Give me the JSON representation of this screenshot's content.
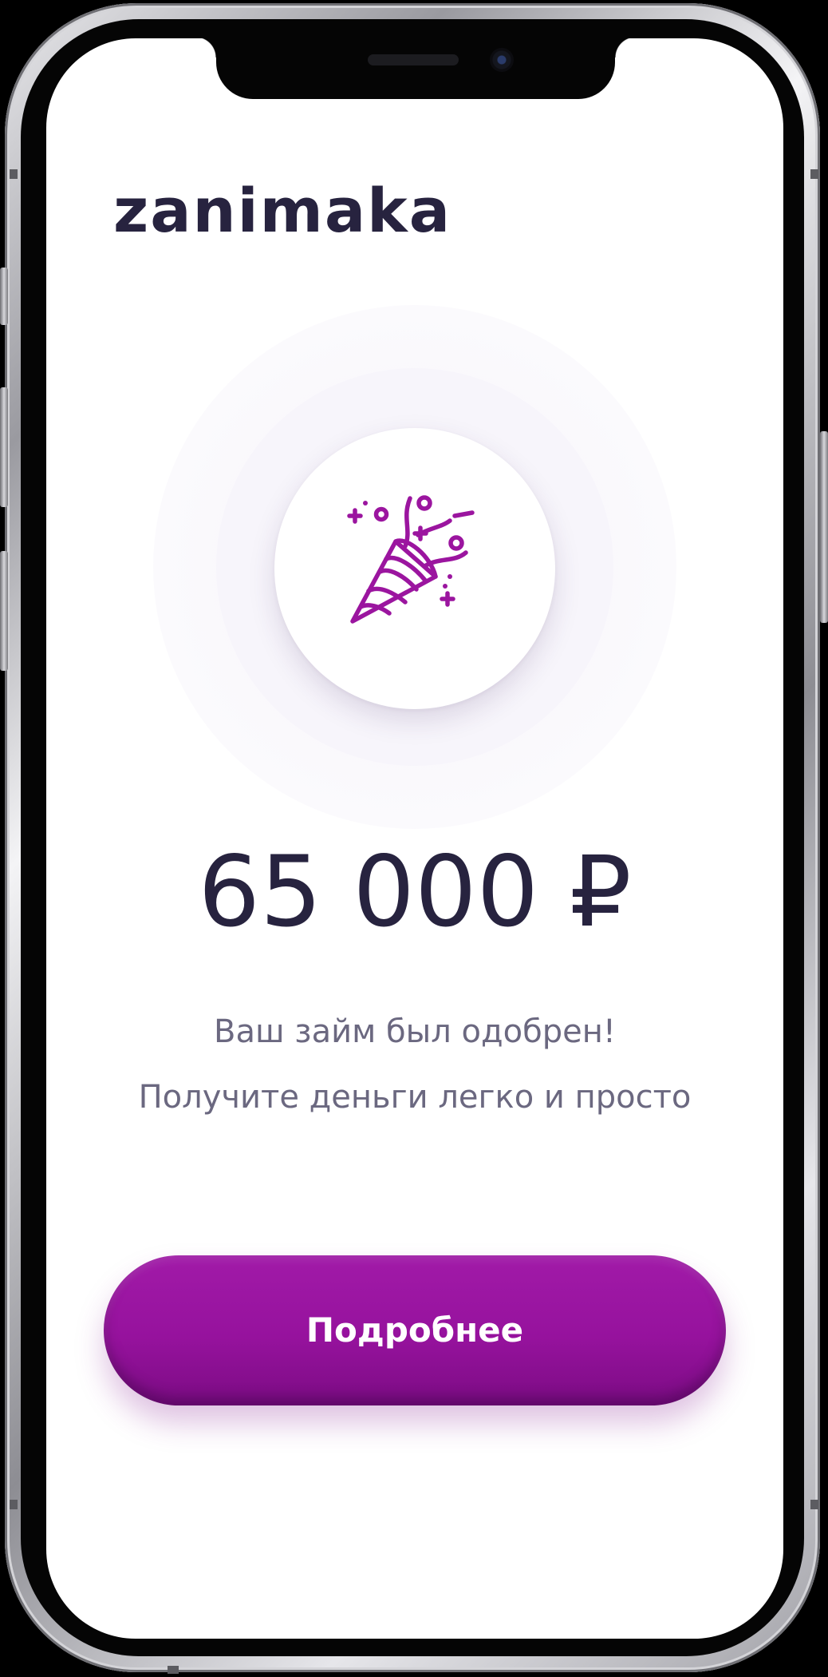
{
  "app": {
    "brand": "zanimaka"
  },
  "offer": {
    "amount": "65 000 ₽",
    "approved_text": "Ваш займ был одобрен!",
    "tagline": "Получите деньги легко и просто"
  },
  "actions": {
    "more_label": "Подробнее"
  },
  "icons": {
    "hero": "party-popper-icon"
  },
  "colors": {
    "brand_text": "#27233f",
    "accent": "#9b159f",
    "secondary_text": "#6b6880",
    "background": "#ffffff"
  }
}
